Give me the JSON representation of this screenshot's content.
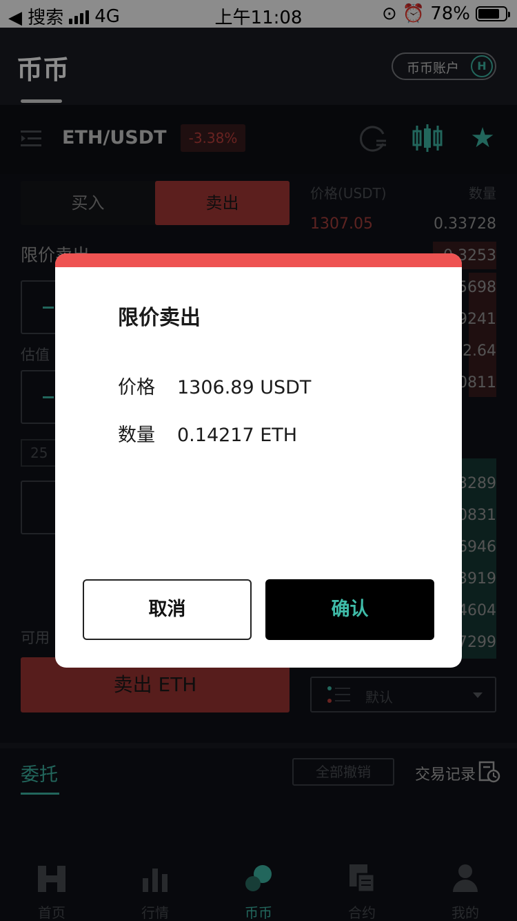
{
  "status_bar": {
    "back_label": "◀ 搜索",
    "network": "4G",
    "time": "上午11:08",
    "battery_text": "78%",
    "battery_level": 0.78
  },
  "header": {
    "title": "币币",
    "account_button": "币币账户"
  },
  "pair": {
    "name": "ETH/USDT",
    "change": "-3.38%"
  },
  "trade": {
    "buy_tab": "买入",
    "sell_tab": "卖出",
    "order_type": "限价卖出",
    "estimate_label": "估值",
    "percent_label": "25",
    "available_label": "可用",
    "sell_button": "卖出 ETH"
  },
  "order_book": {
    "price_header": "价格(USDT)",
    "qty_header": "数量",
    "first_ask_price": "1307.05",
    "ask_qty": [
      "0.33728",
      "0.3253",
      "5698",
      "9241",
      "2.64",
      "0811"
    ],
    "bid_qty": [
      "3289",
      "0831",
      "6946",
      "3919",
      "4604",
      "7299"
    ],
    "depth_select": "默认"
  },
  "orders": {
    "tab": "委托",
    "cancel_all": "全部撤销",
    "history": "交易记录"
  },
  "tabbar": [
    "首页",
    "行情",
    "币币",
    "合约",
    "我的"
  ],
  "modal": {
    "title": "限价卖出",
    "price_label": "价格",
    "price_value": "1306.89 USDT",
    "qty_label": "数量",
    "qty_value": "0.14217 ETH",
    "cancel": "取消",
    "confirm": "确认"
  },
  "colors": {
    "accent": "#3fbba8",
    "sell_red": "#ee5352",
    "background": "#101218"
  }
}
